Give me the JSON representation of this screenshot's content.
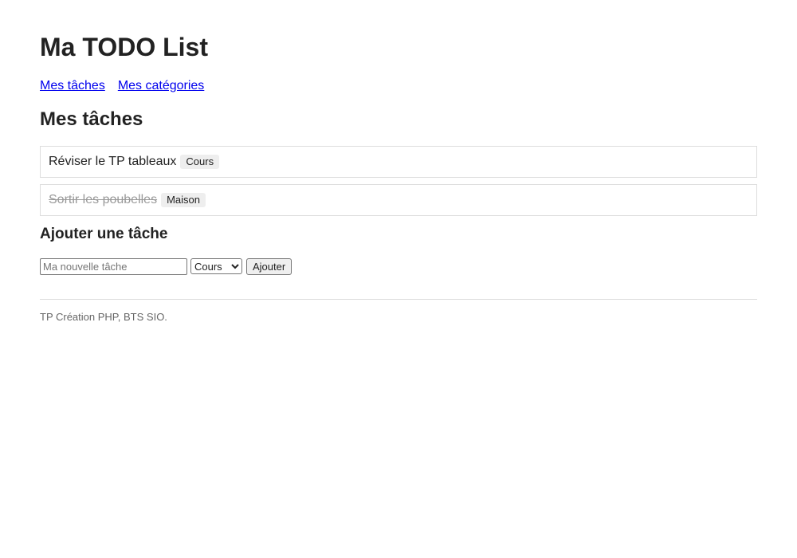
{
  "header": {
    "title": "Ma TODO List"
  },
  "nav": {
    "items": [
      {
        "label": "Mes tâches"
      },
      {
        "label": "Mes catégories"
      }
    ]
  },
  "main": {
    "section_title": "Mes tâches",
    "tasks": [
      {
        "label": "Réviser le TP tableaux",
        "category": "Cours",
        "done": false
      },
      {
        "label": "Sortir les poubelles",
        "category": "Maison",
        "done": true
      }
    ]
  },
  "form": {
    "title": "Ajouter une tâche",
    "input_placeholder": "Ma nouvelle tâche",
    "input_value": "",
    "category_selected": "Cours",
    "submit_label": "Ajouter"
  },
  "footer": {
    "text": "TP Création PHP, BTS SIO."
  },
  "colors": {
    "link": "#0000ee",
    "done_text": "#999999",
    "badge_bg": "#eeeeee",
    "border": "#dddddd"
  }
}
